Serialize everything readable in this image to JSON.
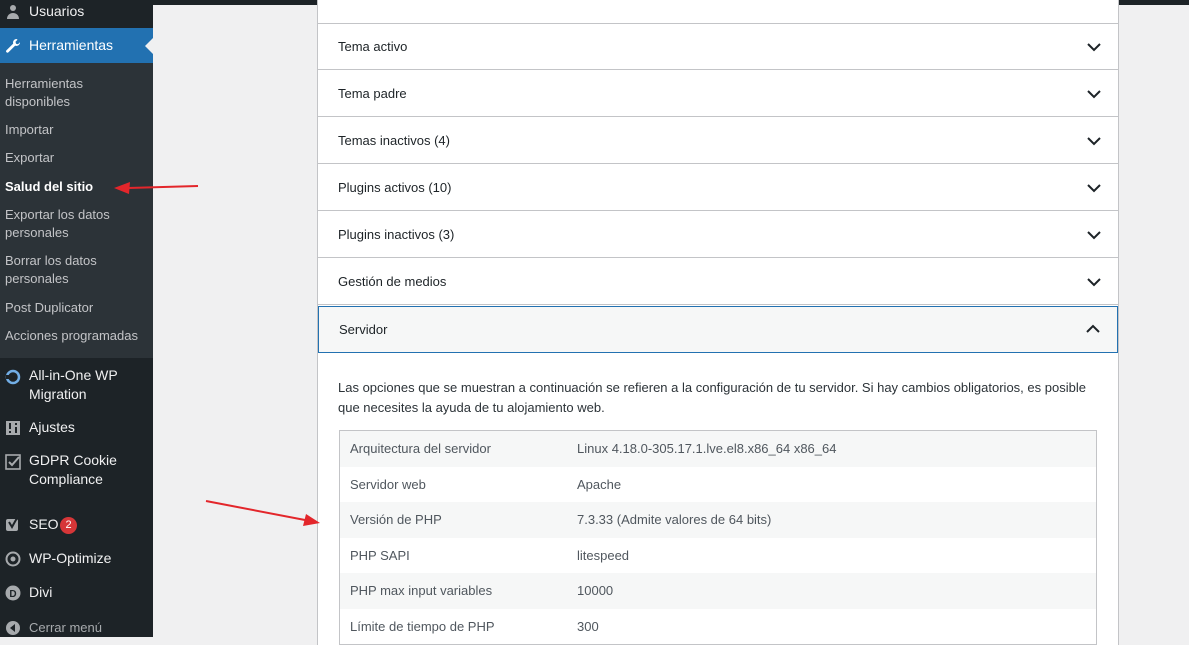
{
  "sidebar": {
    "users": "Usuarios",
    "tools": "Herramientas",
    "submenu": [
      "Herramientas disponibles",
      "Importar",
      "Exportar",
      "Salud del sitio",
      "Exportar los datos personales",
      "Borrar los datos personales",
      "Post Duplicator",
      "Acciones programadas"
    ],
    "migration": "All-in-One WP Migration",
    "settings": "Ajustes",
    "gdpr": "GDPR Cookie Compliance",
    "seo": "SEO",
    "seo_badge": "2",
    "optimize": "WP-Optimize",
    "divi": "Divi",
    "collapse": "Cerrar menú"
  },
  "accordion": {
    "sections": [
      "Tema activo",
      "Tema padre",
      "Temas inactivos (4)",
      "Plugins activos (10)",
      "Plugins inactivos (3)",
      "Gestión de medios"
    ],
    "open_section": "Servidor",
    "description": "Las opciones que se muestran a continuación se refieren a la configuración de tu servidor. Si hay cambios obligatorios, es posible que necesites la ayuda de tu alojamiento web.",
    "rows": [
      {
        "key": "Arquitectura del servidor",
        "value": "Linux 4.18.0-305.17.1.lve.el8.x86_64 x86_64"
      },
      {
        "key": "Servidor web",
        "value": "Apache"
      },
      {
        "key": "Versión de PHP",
        "value": "7.3.33 (Admite valores de 64 bits)"
      },
      {
        "key": "PHP SAPI",
        "value": "litespeed"
      },
      {
        "key": "PHP max input variables",
        "value": "10000"
      },
      {
        "key": "Límite de tiempo de PHP",
        "value": "300"
      }
    ]
  },
  "colors": {
    "sidebar_bg": "#1d2327",
    "submenu_bg": "#2c3338",
    "accent": "#2271b1",
    "badge": "#d63638",
    "annotation_arrow": "#e3262b"
  }
}
